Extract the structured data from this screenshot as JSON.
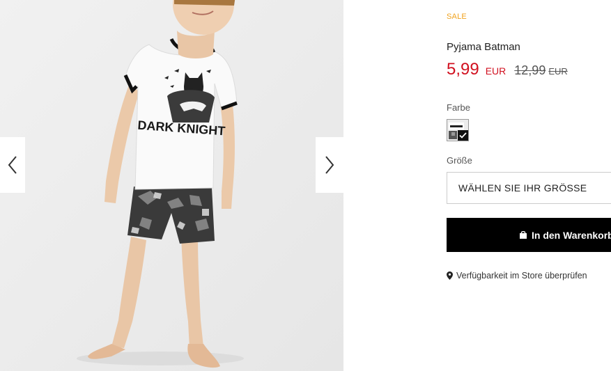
{
  "gallery": {
    "prev_icon": "chevron-left-icon",
    "next_icon": "chevron-right-icon",
    "shirt_print_text": "DARK KNIGHT"
  },
  "product": {
    "badge": "SALE",
    "title": "Pyjama Batman",
    "price": {
      "current": "5,99",
      "currency": "EUR",
      "old": "12,99",
      "old_currency": "EUR"
    },
    "color_label": "Farbe",
    "size_label": "Größe",
    "size_placeholder": "WÄHLEN SIE IHR GRÖSSE",
    "cart_button_label": "In den Warenkorb",
    "store_check_label": "Verfügbarkeit im Store überprüfen"
  },
  "colors": {
    "sale": "#f0a21d",
    "price": "#d1101f",
    "button_bg": "#000000"
  }
}
